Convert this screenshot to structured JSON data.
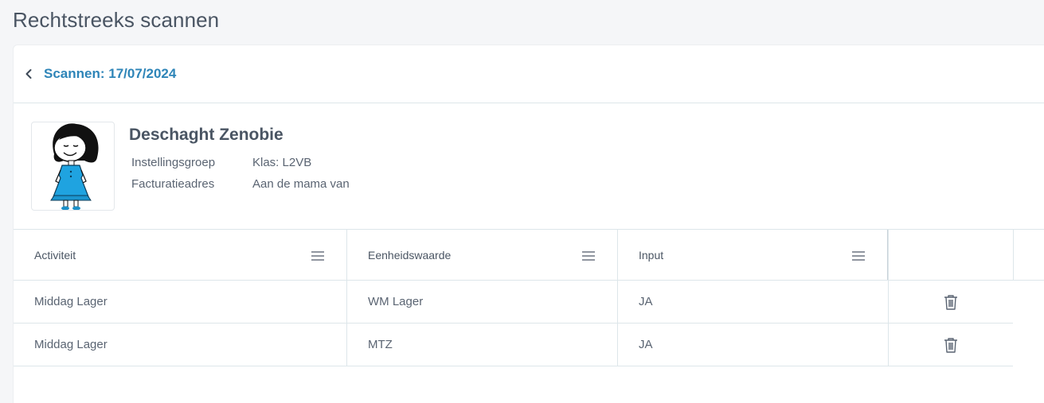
{
  "page": {
    "title": "Rechtstreeks scannen"
  },
  "header": {
    "back_title": "Scannen: 17/07/2024"
  },
  "student": {
    "name": "Deschaght Zenobie",
    "labels": {
      "group": "Instellingsgroep",
      "billing": "Facturatieadres"
    },
    "values": {
      "group": "Klas: L2VB",
      "billing": "Aan de mama van"
    }
  },
  "table": {
    "columns": [
      "Activiteit",
      "Eenheidswaarde",
      "Input"
    ],
    "rows": [
      {
        "activity": "Middag Lager",
        "unit": "WM Lager",
        "input": "JA"
      },
      {
        "activity": "Middag Lager",
        "unit": "MTZ",
        "input": "JA"
      }
    ]
  },
  "colors": {
    "accent": "#2e85b8",
    "text": "#4a5563",
    "border": "#dde6ea"
  },
  "icons": {
    "back": "chevron-left-icon",
    "column_menu": "hamburger-menu-icon",
    "delete": "trash-icon"
  }
}
